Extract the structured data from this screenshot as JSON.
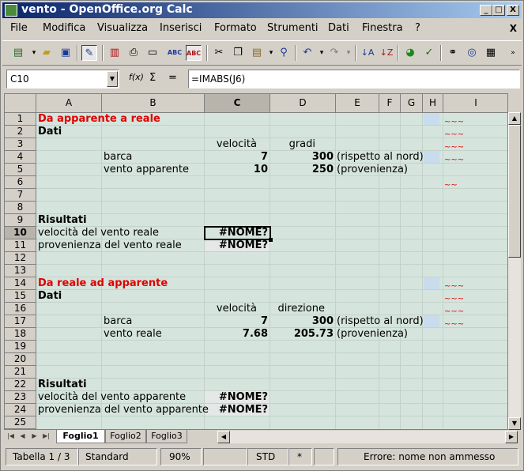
{
  "window": {
    "title": "vento - OpenOffice.org Calc",
    "buttons": {
      "minimize": "_",
      "maximize": "□",
      "close": "X"
    }
  },
  "menu": {
    "items": [
      "File",
      "Modifica",
      "Visualizza",
      "Inserisci",
      "Formato",
      "Strumenti",
      "Dati",
      "Finestra",
      "?"
    ],
    "doc_close": "X"
  },
  "toolbar": {
    "icons": [
      "new-document-icon",
      "open-folder-icon",
      "save-icon",
      "edit-file-icon",
      "export-pdf-icon",
      "print-icon",
      "spellcheck-icon",
      "autospellcheck-icon",
      "cut-icon",
      "copy-icon",
      "paste-icon",
      "clone-format-icon",
      "undo-icon",
      "redo-icon",
      "sort-ascending-icon",
      "sort-descending-icon",
      "chart-icon",
      "draw-icon",
      "find-icon",
      "navigator-icon",
      "gallery-icon"
    ]
  },
  "formula_bar": {
    "name_box": "C10",
    "function_wizard": "f(x)",
    "sum": "Σ",
    "equals": "=",
    "formula": "=IMABS(J6)"
  },
  "sheet": {
    "columns": [
      "A",
      "B",
      "C",
      "D",
      "E",
      "F",
      "G",
      "H",
      "I"
    ],
    "selected_column": "C",
    "rows": [
      "1",
      "2",
      "3",
      "4",
      "5",
      "6",
      "7",
      "8",
      "9",
      "10",
      "11",
      "12",
      "13",
      "14",
      "15",
      "16",
      "17",
      "18",
      "19",
      "20",
      "21",
      "22",
      "23",
      "24",
      "25"
    ],
    "selected_row": "10",
    "cells": {
      "A1": "Da apparente a reale",
      "A2": "Dati",
      "C3": "velocità",
      "D3": "gradi",
      "B4": "barca",
      "C4": "7",
      "D4": "300",
      "E4": "(rispetto al nord)",
      "B5": "vento apparente",
      "C5": "10",
      "D5": "250",
      "E5": "(provenienza)",
      "A9": "Risultati",
      "A10": "velocità del vento reale",
      "C10": "#NOME?",
      "A11": "provenienza del vento reale",
      "C11": "#NOME?",
      "A14": "Da reale ad apparente",
      "A15": "Dati",
      "C16": "velocità",
      "D16": "direzione",
      "B17": "barca",
      "C17": "7",
      "D17": "300",
      "E17": "(rispetto al nord)",
      "B18": "vento reale",
      "C18": "7.68",
      "D18": "205.73",
      "E18": "(provenienza)",
      "A22": "Risultati",
      "A23": "velocità del vento apparente",
      "C23": "#NOME?",
      "A24": "provenienza del vento apparente",
      "C24": "#NOME?"
    }
  },
  "tabs": {
    "sheets": [
      "Foglio1",
      "Foglio2",
      "Foglio3"
    ],
    "active": "Foglio1"
  },
  "status_bar": {
    "sheet": "Tabella 1 / 3",
    "page_style": "Standard",
    "zoom": "90%",
    "mode": "STD",
    "modified": "*",
    "message": "Errore: nome non ammesso"
  },
  "colors": {
    "sheet_background": "#d5e4dc",
    "error_text": "#e00000",
    "title_bar": "#0a246a"
  }
}
